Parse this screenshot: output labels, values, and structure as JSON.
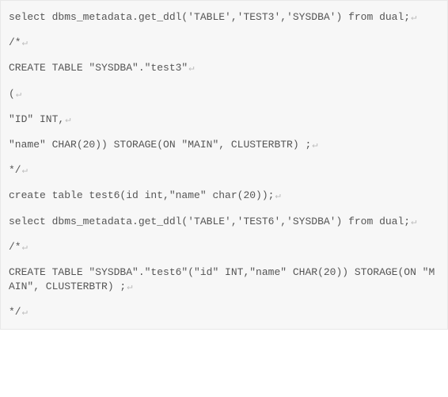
{
  "code": {
    "lines": [
      "select dbms_metadata.get_ddl('TABLE','TEST3','SYSDBA') from dual;",
      "/*",
      "CREATE TABLE \"SYSDBA\".\"test3\"",
      "(",
      "\"ID\" INT,",
      "\"name\" CHAR(20)) STORAGE(ON \"MAIN\", CLUSTERBTR) ;",
      "*/",
      "create table test6(id int,\"name\" char(20));",
      "select dbms_metadata.get_ddl('TABLE','TEST6','SYSDBA') from dual;",
      "/*",
      "CREATE TABLE \"SYSDBA\".\"test6\"(\"id\" INT,\"name\" CHAR(20)) STORAGE(ON \"MAIN\", CLUSTERBTR) ;",
      "*/"
    ],
    "eol_marker": "↵"
  }
}
